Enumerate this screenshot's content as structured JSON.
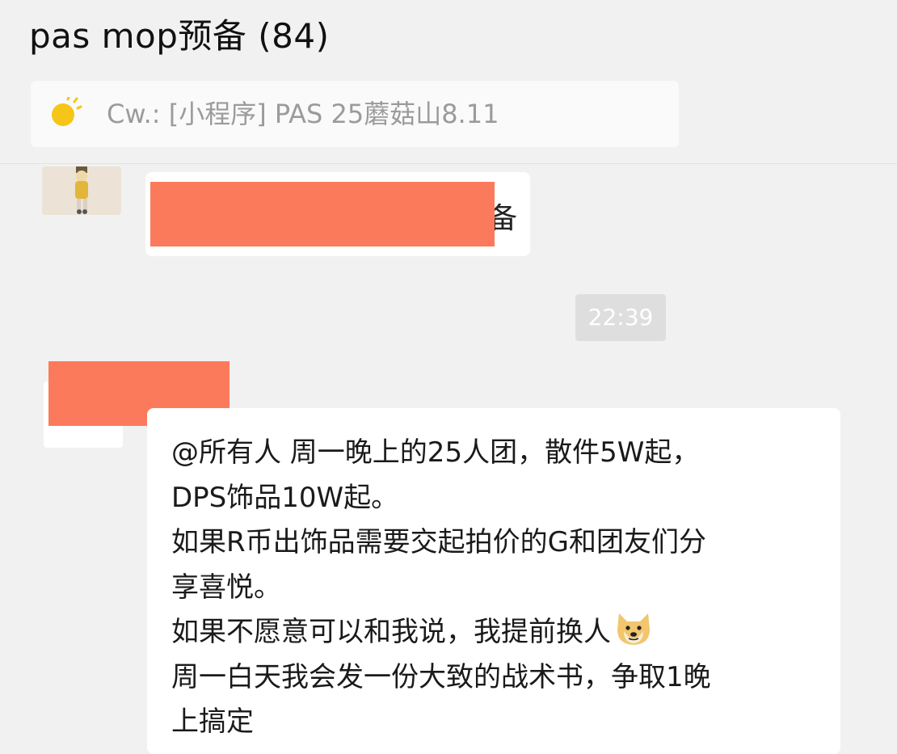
{
  "header": {
    "title": "pas mop预备 (84)"
  },
  "pinned": {
    "icon": "sun-weather-icon",
    "text": "Cw.: [小程序] PAS 25蘑菇山8.11"
  },
  "messages": [
    {
      "avatar": "figurine-avatar",
      "redacted": true,
      "visible_tail": "备"
    },
    {
      "type": "timestamp",
      "text": "22:39"
    },
    {
      "avatar": "avatar",
      "redacted_name": true,
      "lines": [
        "@所有人 周一晚上的25人团，散件5W起，",
        "DPS饰品10W起。",
        "如果R币出饰品需要交起拍价的G和团友们分",
        "享喜悦。",
        "如果不愿意可以和我说，我提前换人",
        "周一白天我会发一份大致的战术书，争取1晚",
        "上搞定"
      ],
      "emoji": "doge-face-icon"
    }
  ],
  "colors": {
    "background": "#f1f1f1",
    "bubble": "#ffffff",
    "redaction": "#fc7a5c",
    "timestamp_bg": "#dedede",
    "pinned_text": "#9b9b9b"
  }
}
